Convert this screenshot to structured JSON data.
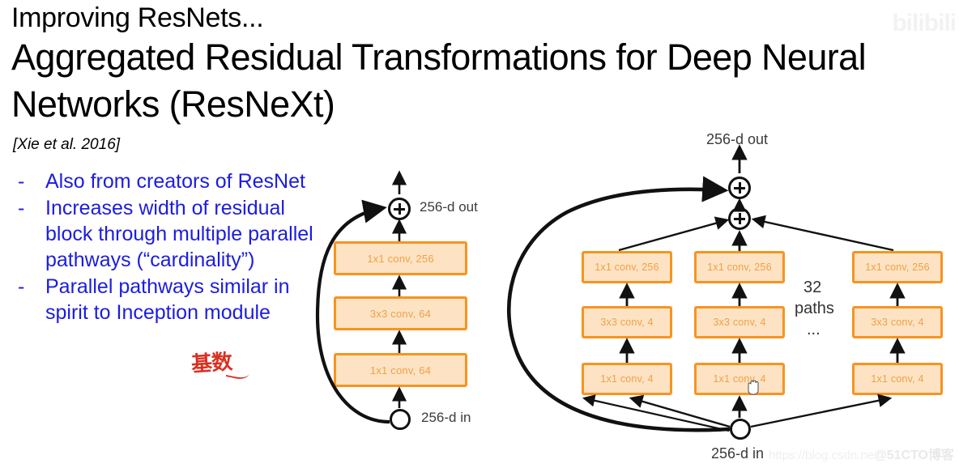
{
  "slide": {
    "eyebrow": "Improving ResNets...",
    "title": "Aggregated Residual Transformations for Deep Neural Networks (ResNeXt)",
    "citation": "[Xie et al. 2016]",
    "annotation_cjk": "基数",
    "accent_blue": "#1C1CE0",
    "accent_orange": "#F79420",
    "box_fill": "#FDE3C4",
    "annotation_red": "#D93022"
  },
  "bullets": [
    {
      "marker": "-",
      "text": "Also from creators of ResNet"
    },
    {
      "marker": "-",
      "text": "Increases width of residual block through multiple parallel pathways (“cardinality”)"
    },
    {
      "marker": "-",
      "text": "Parallel pathways similar in spirit to Inception module"
    }
  ],
  "left_diagram": {
    "name": "resnet-bottleneck-block",
    "out_label": "256-d out",
    "in_label": "256-d in",
    "boxes": [
      {
        "label": "1x1 conv, 256"
      },
      {
        "label": "3x3 conv, 64"
      },
      {
        "label": "1x1 conv, 64"
      }
    ]
  },
  "right_diagram": {
    "name": "resnext-block",
    "out_label": "256-d out",
    "in_label": "256-d in",
    "paths_count": "32",
    "paths_label": "paths",
    "paths_ellipsis": "...",
    "columns": [
      {
        "boxes": [
          {
            "label": "1x1 conv, 256"
          },
          {
            "label": "3x3 conv, 4"
          },
          {
            "label": "1x1 conv, 4"
          }
        ]
      },
      {
        "boxes": [
          {
            "label": "1x1 conv, 256"
          },
          {
            "label": "3x3 conv, 4"
          },
          {
            "label": "1x1 conv, 4"
          }
        ]
      },
      {
        "boxes": [
          {
            "label": "1x1 conv, 256"
          },
          {
            "label": "3x3 conv, 4"
          },
          {
            "label": "1x1 conv, 4"
          }
        ]
      }
    ]
  },
  "watermarks": {
    "top_right": "bilibili",
    "bottom_right_url": "https://blog.csdn.ne",
    "bottom_right_tag": "@51CTO博客"
  }
}
